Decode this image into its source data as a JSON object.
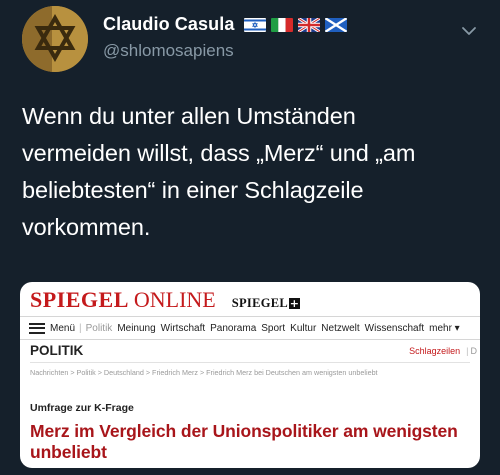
{
  "author": {
    "display_name": "Claudio Casula",
    "handle": "@shlomosapiens",
    "flags": [
      "israel-flag",
      "italy-flag",
      "uk-flag",
      "scotland-flag"
    ]
  },
  "tweet": {
    "text_lines": [
      "Wenn du unter allen Umständen",
      "vermeiden willst, dass „Merz“ und „am",
      "beliebtesten“ in einer Schlagzeile",
      "vorkommen."
    ]
  },
  "screenshot": {
    "logo_spiegel": "SPIEGEL",
    "logo_online": "ONLINE",
    "spiegel_plus": "SPIEGEL",
    "plus_symbol": "+",
    "nav": {
      "menu_label": "Menü",
      "items": [
        "Politik",
        "Meinung",
        "Wirtschaft",
        "Panorama",
        "Sport",
        "Kultur",
        "Netzwelt",
        "Wissenschaft"
      ],
      "more": "mehr ▾"
    },
    "section_title": "POLITIK",
    "schlagzeilen": "Schlagzeilen",
    "schlagzeilen_extra": "D",
    "breadcrumb": "Nachrichten > Politik > Deutschland > Friedrich Merz > Friedrich Merz bei Deutschen am wenigsten unbeliebt",
    "kicker": "Umfrage zur K-Frage",
    "headline": "Merz im Vergleich der Unionspolitiker am wenigsten unbeliebt"
  },
  "colors": {
    "background": "#15202b",
    "secondary_text": "#8899a6",
    "spiegel_red": "#c41a1c",
    "headline_red": "#a8151a"
  }
}
